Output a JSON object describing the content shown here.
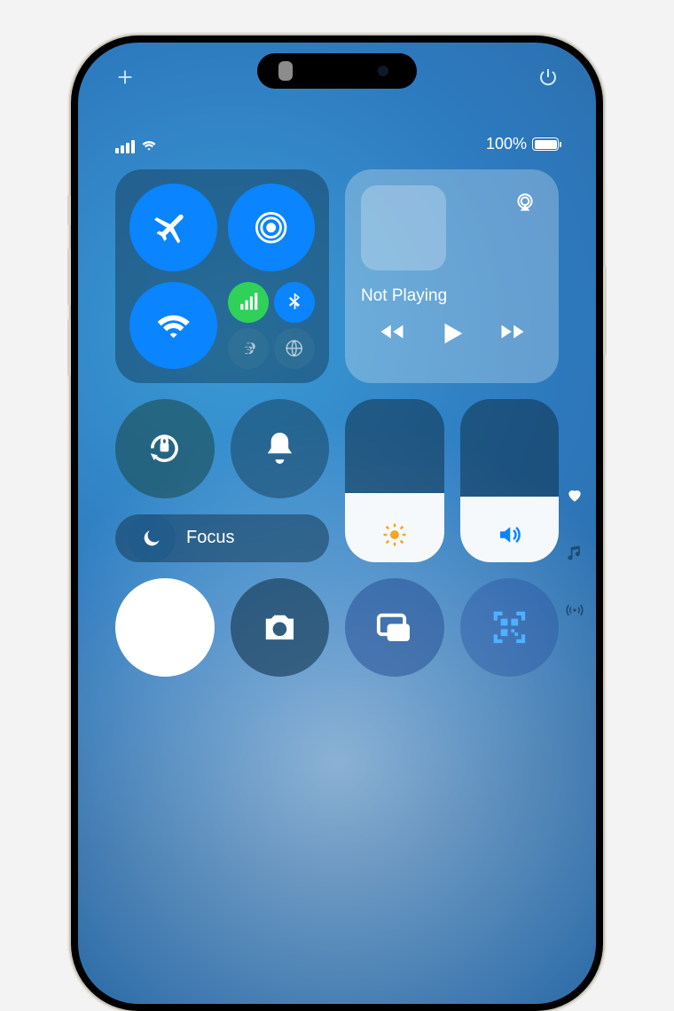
{
  "status": {
    "battery_text": "100%"
  },
  "media": {
    "title": "Not Playing"
  },
  "focus": {
    "label": "Focus"
  },
  "sliders": {
    "brightness_pct": 42,
    "volume_pct": 40
  },
  "icons": {
    "add": "plus-icon",
    "power": "power-icon",
    "airplane": "airplane-icon",
    "airdrop": "airdrop-icon",
    "wifi": "wifi-icon",
    "cellular": "cellular-icon",
    "bluetooth": "bluetooth-icon",
    "hotspot": "hotspot-icon",
    "satellite": "satellite-icon",
    "airplay": "airplay-icon",
    "rewind": "rewind-icon",
    "play": "play-icon",
    "forward": "forward-icon",
    "rotation_lock": "rotation-lock-icon",
    "silent": "bell-icon",
    "moon": "moon-icon",
    "sun": "sun-icon",
    "speaker": "speaker-icon",
    "flashlight": "flashlight-icon",
    "camera": "camera-icon",
    "screen_mirroring": "screen-mirroring-icon",
    "qr": "qr-icon",
    "heart": "heart-icon",
    "music": "music-note-icon",
    "connectivity": "connectivity-icon"
  }
}
